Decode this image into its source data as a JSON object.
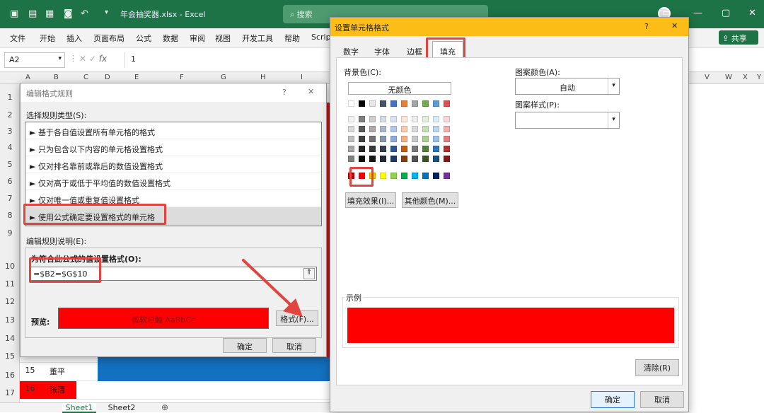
{
  "titlebar": {
    "filename": "年会抽奖器.xlsx",
    "app": "Excel",
    "search_placeholder": "搜索",
    "share": "共享"
  },
  "ribbon": {
    "tabs": [
      "文件",
      "开始",
      "插入",
      "页面布局",
      "公式",
      "数据",
      "审阅",
      "视图",
      "开发工具",
      "帮助",
      "Scrip"
    ]
  },
  "formula_bar": {
    "name_box": "A2",
    "fx": "fx",
    "value": "1"
  },
  "grid": {
    "columns": [
      "A",
      "B",
      "C",
      "D",
      "E",
      "F",
      "G",
      "H",
      "I",
      "V",
      "W",
      "X",
      "Y"
    ],
    "rows": [
      "1",
      "2",
      "3",
      "4",
      "5",
      "6",
      "7",
      "8",
      "9",
      "10",
      "11",
      "12",
      "13",
      "14",
      "15",
      "16",
      "17"
    ],
    "cells": [
      {
        "num": "15",
        "name": "董平"
      },
      {
        "num": "16",
        "name": "张清"
      }
    ],
    "sheets": [
      "Sheet1",
      "Sheet2"
    ]
  },
  "rule_dialog": {
    "title": "编辑格式规则",
    "help": "?",
    "close": "✕",
    "select_type_label": "选择规则类型(S):",
    "rule_types": [
      "► 基于各自值设置所有单元格的格式",
      "► 只为包含以下内容的单元格设置格式",
      "► 仅对排名靠前或靠后的数值设置格式",
      "► 仅对高于或低于平均值的数值设置格式",
      "► 仅对唯一值或重复值设置格式",
      "► 使用公式确定要设置格式的单元格"
    ],
    "description_label": "编辑规则说明(E):",
    "formula_label": "为符合此公式的值设置格式(O):",
    "formula": "=$B2=$G$10",
    "preview_label": "预览:",
    "preview_text": "微软卓越  AaBbCc",
    "format_button": "格式(F)...",
    "ok": "确定",
    "cancel": "取消"
  },
  "format_dialog": {
    "title": "设置单元格格式",
    "help": "?",
    "close": "✕",
    "tabs": [
      "数字",
      "字体",
      "边框",
      "填充"
    ],
    "active_tab": "填充",
    "bg_color_label": "背景色(C):",
    "no_color": "无颜色",
    "pattern_color_label": "图案颜色(A):",
    "pattern_color_value": "自动",
    "pattern_style_label": "图案样式(P):",
    "fill_effects": "填充效果(I)...",
    "more_colors": "其他颜色(M)...",
    "sample_label": "示例",
    "sample_color": "#ff0000",
    "clear": "清除(R)",
    "ok": "确定",
    "cancel": "取消"
  },
  "colors": {
    "accent": "#1d7345",
    "highlight": "#e0463f",
    "dialog_title": "#fbbd16",
    "fill_red": "#ff0000"
  }
}
